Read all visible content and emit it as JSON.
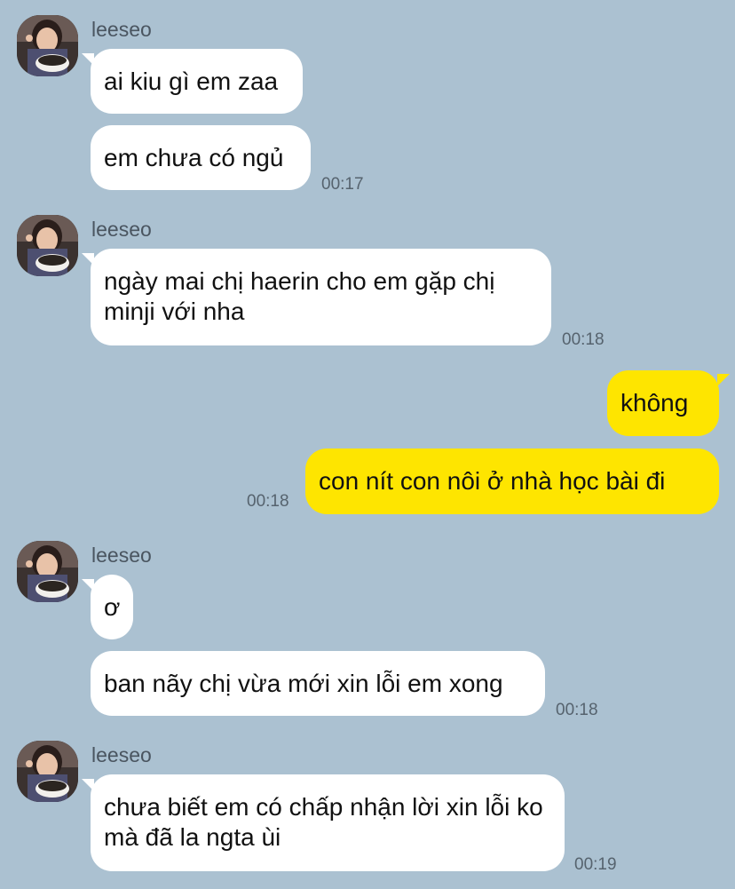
{
  "sender_name": "leeseo",
  "colors": {
    "background": "#abc1d1",
    "incoming_bubble": "#ffffff",
    "outgoing_bubble": "#fee500",
    "timestamp": "#56636e"
  },
  "groups": [
    {
      "sender": "leeseo",
      "messages": [
        {
          "text": "ai kiu gì em zaa"
        },
        {
          "text": "em chưa có ngủ"
        }
      ],
      "time": "00:17"
    },
    {
      "sender": "leeseo",
      "messages": [
        {
          "text": "ngày mai chị haerin cho em gặp chị minji với nha"
        }
      ],
      "time": "00:18"
    },
    {
      "sender": "me",
      "messages": [
        {
          "text": "không"
        },
        {
          "text": "con nít con nôi ở nhà học bài đi"
        }
      ],
      "time": "00:18"
    },
    {
      "sender": "leeseo",
      "messages": [
        {
          "text": "ơ"
        },
        {
          "text": "ban nãy chị vừa mới xin lỗi em xong"
        }
      ],
      "time": "00:18"
    },
    {
      "sender": "leeseo",
      "messages": [
        {
          "text": "chưa biết em có chấp nhận lời xin lỗi ko mà đã la ngta ùi"
        }
      ],
      "time": "00:19"
    }
  ]
}
